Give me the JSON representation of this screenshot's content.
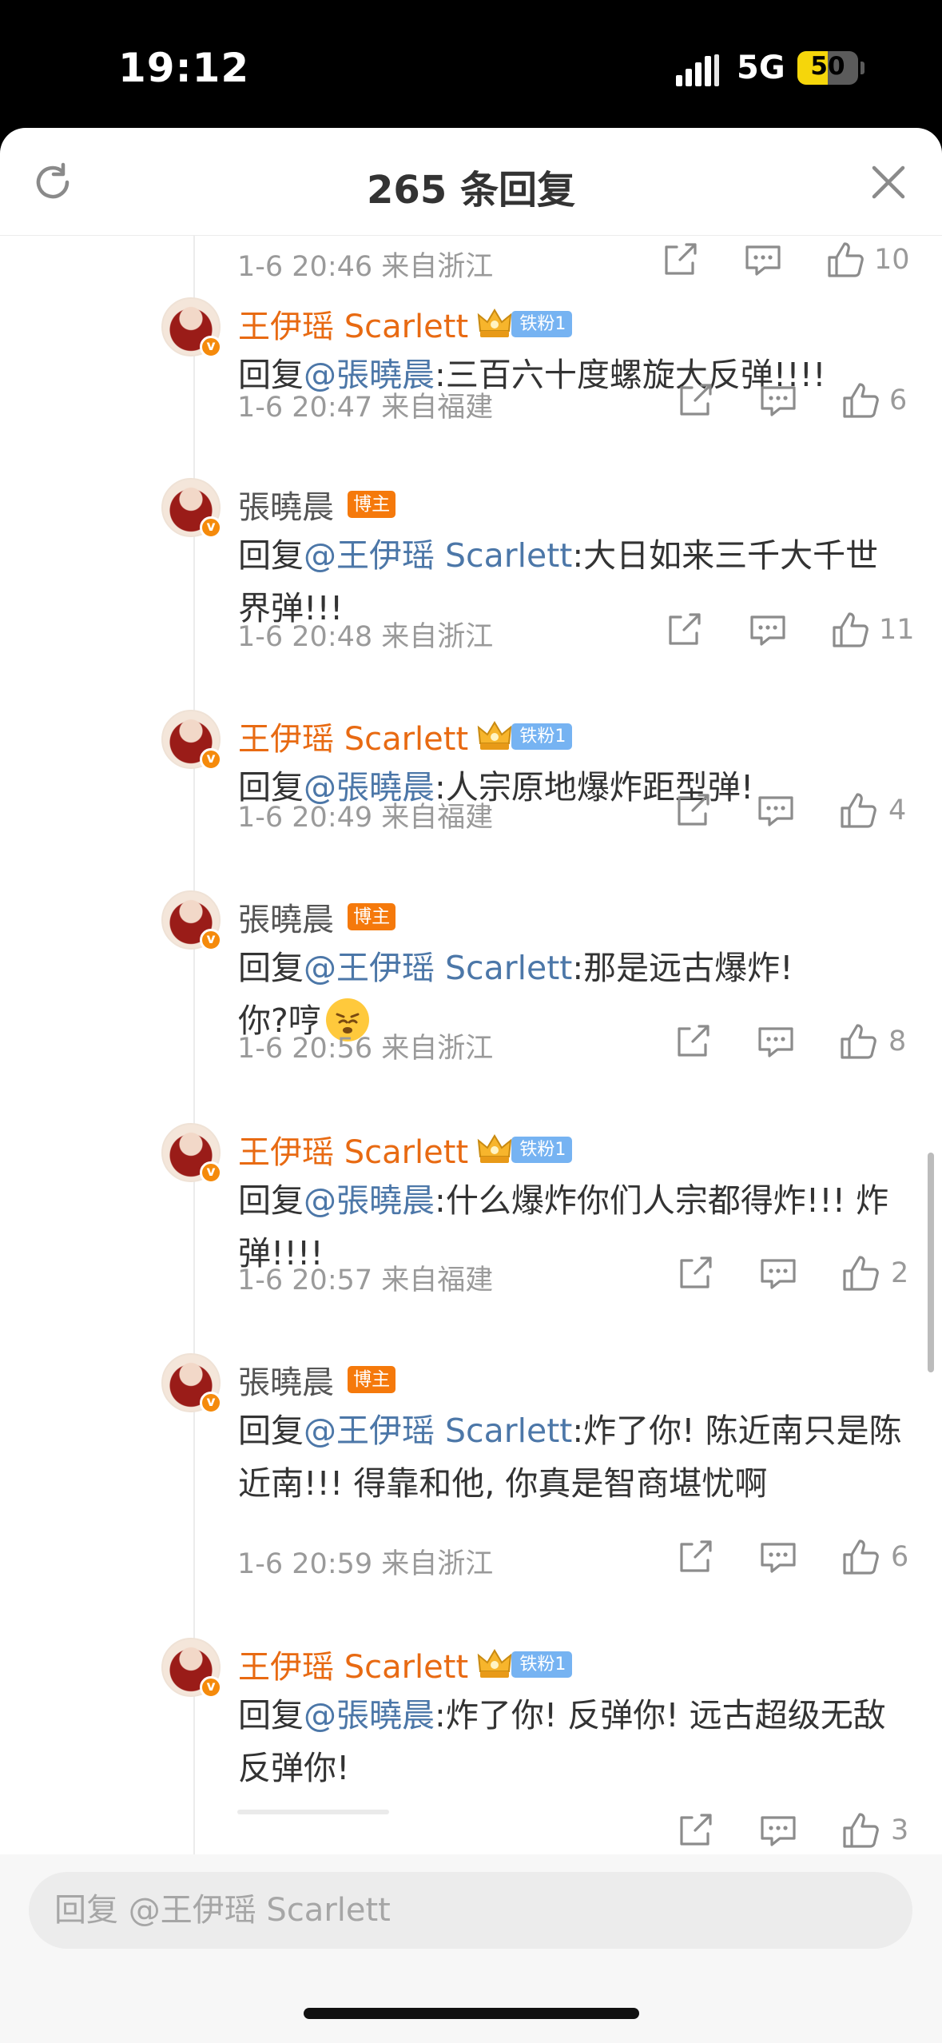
{
  "status_bar": {
    "time": "19:12",
    "network": "5G",
    "battery": "50",
    "battery_level": 0.5
  },
  "header": {
    "title": "265 条回复",
    "refresh_icon": "refresh-icon",
    "close_icon": "close-icon"
  },
  "top_meta": {
    "time_loc": "1-6 20:46  来自浙江",
    "likes": "10"
  },
  "comments": [
    {
      "name": "王伊瑶 Scarlett",
      "fan_badge": "铁粉1",
      "reply_prefix": "回复",
      "mention": "@張曉晨",
      "text": ":三百六十度螺旋大反弹!!!!",
      "time_loc": "1-6 20:47  来自福建",
      "likes": "6"
    },
    {
      "name": "張曉晨",
      "host_badge": "博主",
      "reply_prefix": "回复",
      "mention": "@王伊瑶 Scarlett",
      "text": ":大日如来三千大千世界弹!!!",
      "time_loc": "1-6 20:48  来自浙江",
      "likes": "11"
    },
    {
      "name": "王伊瑶 Scarlett",
      "fan_badge": "铁粉1",
      "reply_prefix": "回复",
      "mention": "@張曉晨",
      "text": ":人宗原地爆炸距型弹!",
      "time_loc": "1-6 20:49  来自福建",
      "likes": "4"
    },
    {
      "name": "張曉晨",
      "host_badge": "博主",
      "reply_prefix": "回复",
      "mention": "@王伊瑶 Scarlett",
      "text": ":那是远古爆炸!",
      "text2": "你?哼",
      "time_loc": "1-6 20:56  来自浙江",
      "likes": "8"
    },
    {
      "name": "王伊瑶 Scarlett",
      "fan_badge": "铁粉1",
      "reply_prefix": "回复",
      "mention": "@張曉晨",
      "text": ":什么爆炸你们人宗都得炸!!! 炸弹!!!!",
      "time_loc": "1-6 20:57  来自福建",
      "likes": "2"
    },
    {
      "name": "張曉晨",
      "host_badge": "博主",
      "reply_prefix": "回复",
      "mention": "@王伊瑶 Scarlett",
      "text": ":炸了你! 陈近南只是陈近南!!! 得靠和他, 你真是智商堪忧啊",
      "time_loc": "1-6 20:59  来自浙江",
      "likes": "6"
    },
    {
      "name": "王伊瑶 Scarlett",
      "fan_badge": "铁粉1",
      "reply_prefix": "回复",
      "mention": "@張曉晨",
      "text": ":炸了你! 反弹你! 远古超级无敌反弹你!",
      "likes": "3"
    }
  ],
  "reply_box": {
    "placeholder": "回复 @王伊瑶 Scarlett"
  }
}
